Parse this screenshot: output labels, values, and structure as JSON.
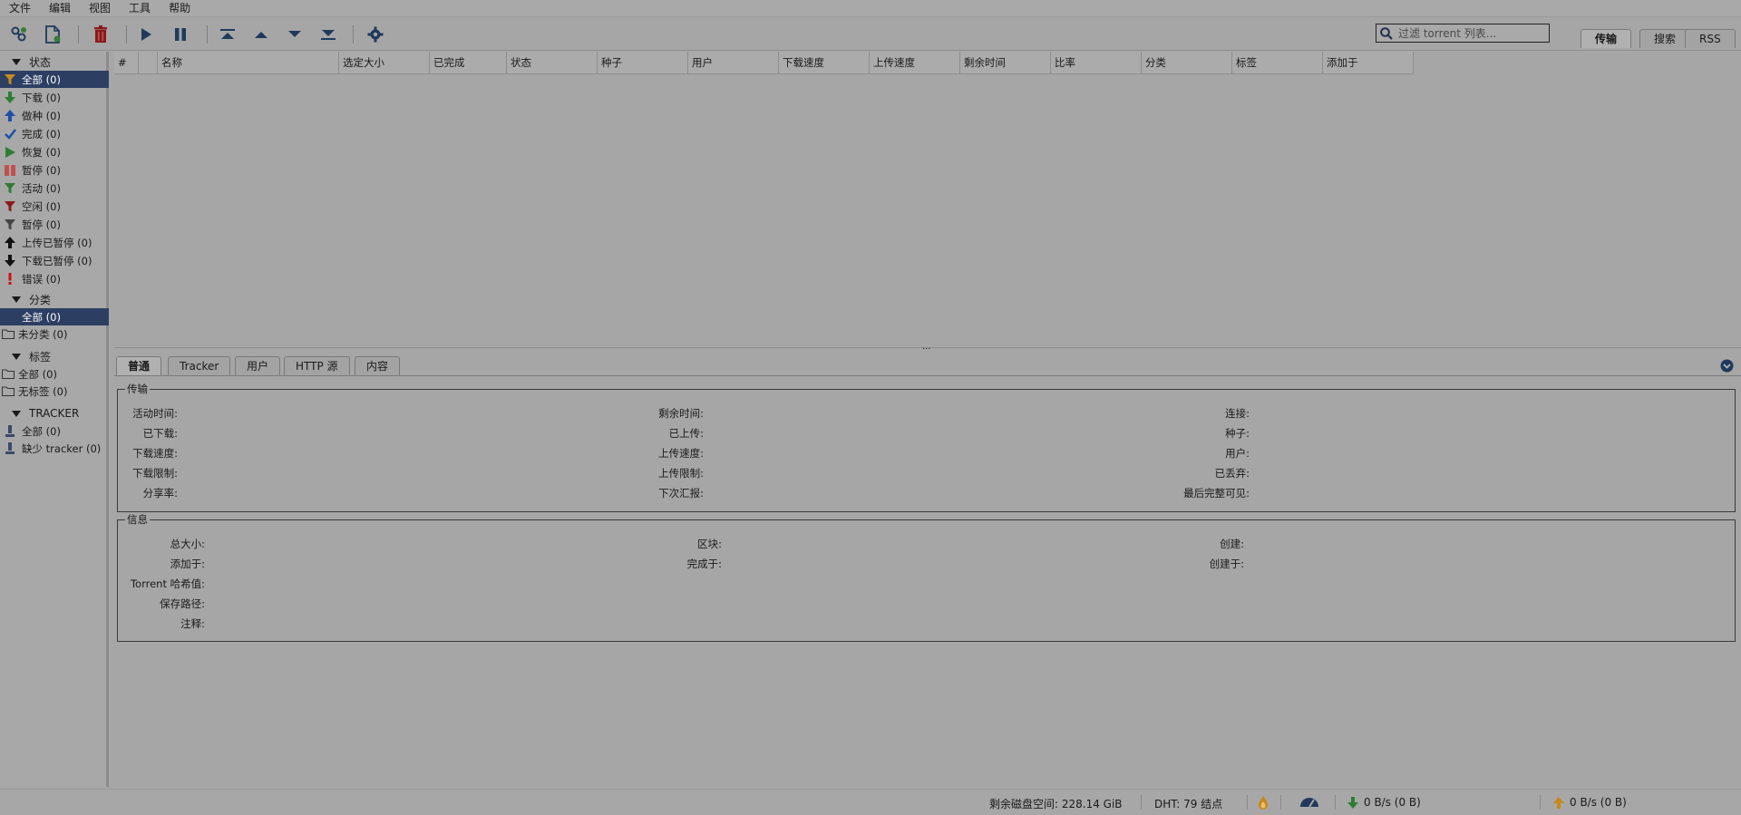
{
  "menu": [
    "文件",
    "编辑",
    "视图",
    "工具",
    "帮助"
  ],
  "search": {
    "placeholder": "过滤 torrent 列表..."
  },
  "top_tabs": [
    "传输",
    "搜索",
    "RSS"
  ],
  "sidebar": {
    "status_header": "状态",
    "status_items": [
      {
        "label": "全部 (0)",
        "icon": "filter-icon",
        "color": "#c8891c"
      },
      {
        "label": "下载 (0)",
        "icon": "arrow-down-icon",
        "color": "#2e7d32"
      },
      {
        "label": "做种 (0)",
        "icon": "arrow-up-icon",
        "color": "#1f4fa8"
      },
      {
        "label": "完成 (0)",
        "icon": "check-icon",
        "color": "#1f4fa8"
      },
      {
        "label": "恢复 (0)",
        "icon": "play-icon",
        "color": "#2e7d32"
      },
      {
        "label": "暂停 (0)",
        "icon": "pause-icon",
        "color": "#c0504d"
      },
      {
        "label": "活动 (0)",
        "icon": "filter-icon",
        "color": "#2e7d32"
      },
      {
        "label": "空闲 (0)",
        "icon": "filter-icon",
        "color": "#8b1a1a"
      },
      {
        "label": "暂停 (0)",
        "icon": "filter-icon",
        "color": "#444444"
      },
      {
        "label": "上传已暂停 (0)",
        "icon": "arrow-up-icon",
        "color": "#111111"
      },
      {
        "label": "下载已暂停 (0)",
        "icon": "arrow-down-icon",
        "color": "#111111"
      },
      {
        "label": "错误 (0)",
        "icon": "exclamation-icon",
        "color": "#cc1111"
      }
    ],
    "category_header": "分类",
    "category_items": [
      "全部 (0)",
      "未分类 (0)"
    ],
    "tag_header": "标签",
    "tag_items": [
      "全部 (0)",
      "无标签 (0)"
    ],
    "tracker_header": "TRACKER",
    "tracker_items": [
      "全部 (0)",
      "缺少 tracker (0)"
    ]
  },
  "columns": [
    "#",
    "",
    "名称",
    "选定大小",
    "已完成",
    "状态",
    "种子",
    "用户",
    "下载速度",
    "上传速度",
    "剩余时间",
    "比率",
    "分类",
    "标签",
    "添加于"
  ],
  "bottom_tabs": [
    "普通",
    "Tracker",
    "用户",
    "HTTP 源",
    "内容"
  ],
  "transfer": {
    "title": "传输",
    "col1": [
      "活动时间:",
      "已下载:",
      "下载速度:",
      "下载限制:",
      "分享率:"
    ],
    "col2": [
      "剩余时间:",
      "已上传:",
      "上传速度:",
      "上传限制:",
      "下次汇报:"
    ],
    "col3": [
      "连接:",
      "种子:",
      "用户:",
      "已丢弃:",
      "最后完整可见:"
    ]
  },
  "info": {
    "title": "信息",
    "col1": [
      "总大小:",
      "添加于:",
      "Torrent 哈希值:",
      "保存路径:",
      "注释:"
    ],
    "col2": [
      "区块:",
      "完成于:"
    ],
    "col3": [
      "创建:",
      "创建于:"
    ]
  },
  "status_bar": {
    "disk_free": "剩余磁盘空间: 228.14 GiB",
    "dht": "DHT: 79 结点",
    "download": "0 B/s (0 B)",
    "upload": "0 B/s (0 B)"
  }
}
